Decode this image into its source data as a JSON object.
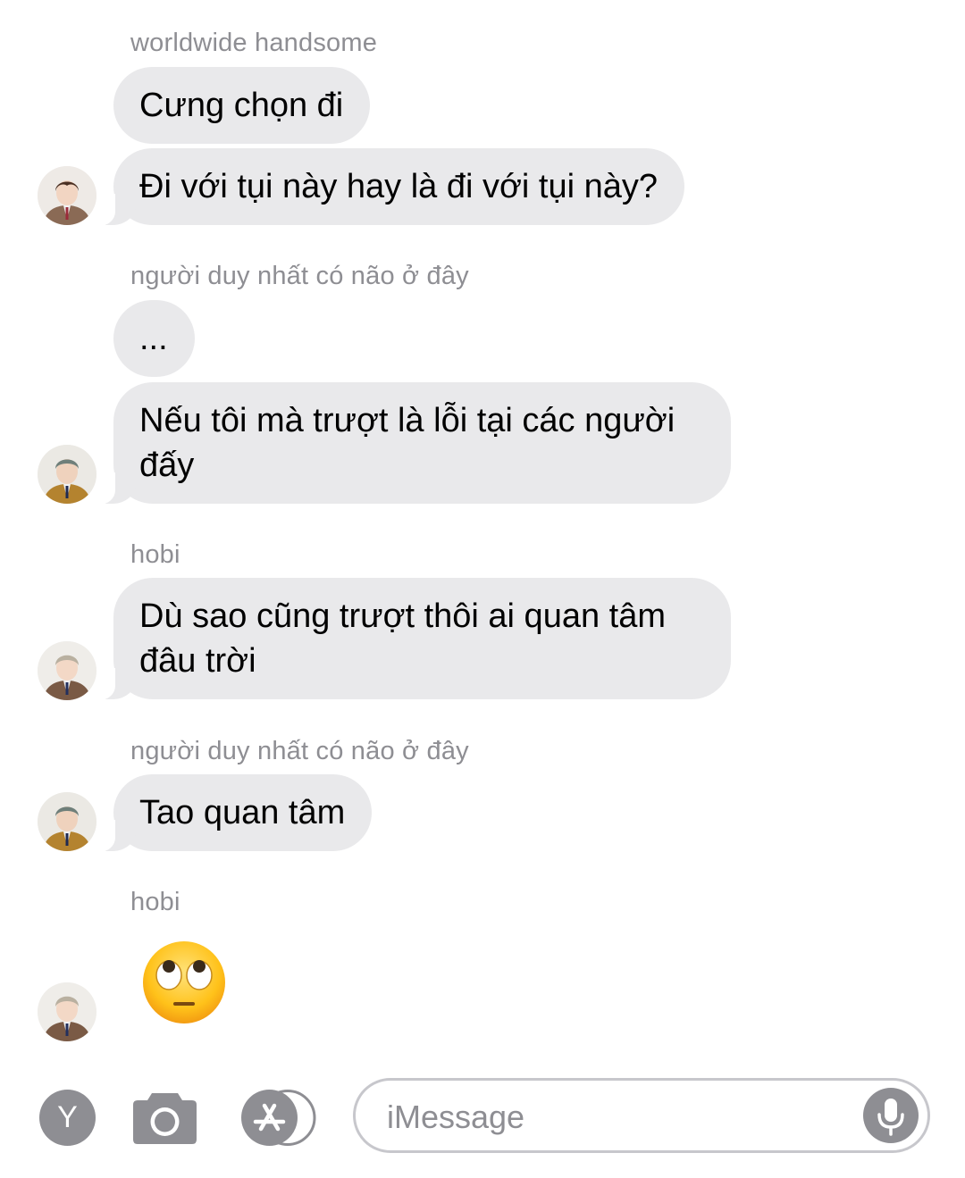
{
  "messages": [
    {
      "sender": "worldwide handsome",
      "bubbles": [
        "Cưng chọn đi",
        "Đi với tụi này hay là đi với tụi này?"
      ]
    },
    {
      "sender": "người duy nhất có não ở đây",
      "bubbles": [
        "...",
        "Nếu tôi mà trượt là lỗi tại các người đấy"
      ]
    },
    {
      "sender": "hobi",
      "bubbles": [
        "Dù sao cũng trượt thôi ai quan tâm đâu trời"
      ]
    },
    {
      "sender": "người duy nhất có não ở đây",
      "bubbles": [
        "Tao quan tâm"
      ]
    },
    {
      "sender": "hobi",
      "emoji": "eye-roll-emoji"
    }
  ],
  "toolbar": {
    "profile_initial": "Y",
    "input_placeholder": "iMessage",
    "icons": [
      "camera-icon",
      "app-store-icon",
      "microphone-icon"
    ]
  },
  "colors": {
    "bubble": "#e9e9eb",
    "sender_text": "#8e8e93",
    "toolbar_icon": "#8e8e93"
  }
}
